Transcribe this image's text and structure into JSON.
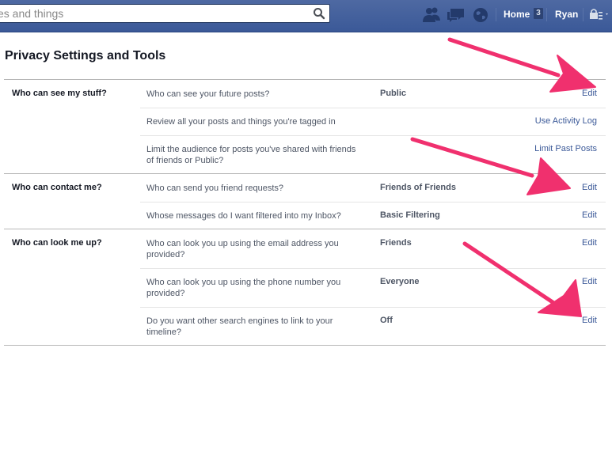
{
  "header": {
    "search_placeholder": "es and things",
    "home_label": "Home",
    "home_badge": "3",
    "user_name": "Ryan",
    "colors": {
      "bar": "#3b5998",
      "bar_light": "#4e69a2",
      "accent_arrow": "#f0306e"
    },
    "icons": [
      "friend-requests-icon",
      "messages-icon",
      "notifications-globe-icon",
      "privacy-shortcuts-icon"
    ]
  },
  "page": {
    "title": "Privacy Settings and Tools"
  },
  "sections": [
    {
      "title": "Who can see my stuff?",
      "rows": [
        {
          "question": "Who can see your future posts?",
          "value": "Public",
          "action": "Edit"
        },
        {
          "question": "Review all your posts and things you're tagged in",
          "value": "",
          "action": "Use Activity Log"
        },
        {
          "question": "Limit the audience for posts you've shared with friends of friends or Public?",
          "value": "",
          "action": "Limit Past Posts"
        }
      ]
    },
    {
      "title": "Who can contact me?",
      "rows": [
        {
          "question": "Who can send you friend requests?",
          "value": "Friends of Friends",
          "action": "Edit"
        },
        {
          "question": "Whose messages do I want filtered into my Inbox?",
          "value": "Basic Filtering",
          "action": "Edit"
        }
      ]
    },
    {
      "title": "Who can look me up?",
      "rows": [
        {
          "question": "Who can look you up using the email address you provided?",
          "value": "Friends",
          "action": "Edit"
        },
        {
          "question": "Who can look you up using the phone number you provided?",
          "value": "Everyone",
          "action": "Edit"
        },
        {
          "question": "Do you want other search engines to link to your timeline?",
          "value": "Off",
          "action": "Edit"
        }
      ]
    }
  ]
}
